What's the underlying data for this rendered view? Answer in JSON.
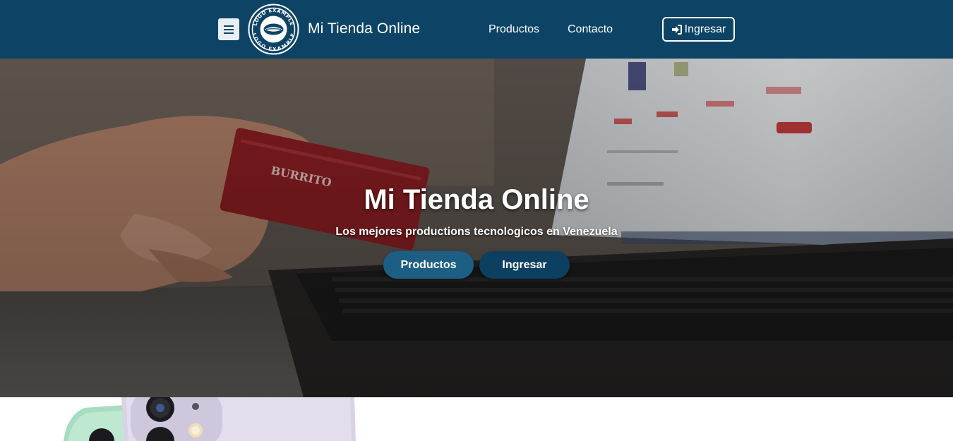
{
  "navbar": {
    "brand": "Mi Tienda Online",
    "logo_icon": "lips-logo-icon",
    "logo_text": "LOGO EXAMPLE",
    "menu_icon": "hamburger-menu-icon",
    "links": [
      {
        "label": "Productos"
      },
      {
        "label": "Contacto"
      }
    ],
    "login": {
      "label": "Ingresar",
      "icon": "sign-in-icon"
    },
    "background": "#0d4466"
  },
  "hero": {
    "title": "Mi Tienda Online",
    "subtitle": "Los mejores productions tecnologicos en Venezuela",
    "buttons": [
      {
        "label": "Productos",
        "color": "#1d5f84"
      },
      {
        "label": "Ingresar",
        "color": "#0c3f60"
      }
    ]
  },
  "product_image": {
    "description_icon": "smartphone-image"
  }
}
